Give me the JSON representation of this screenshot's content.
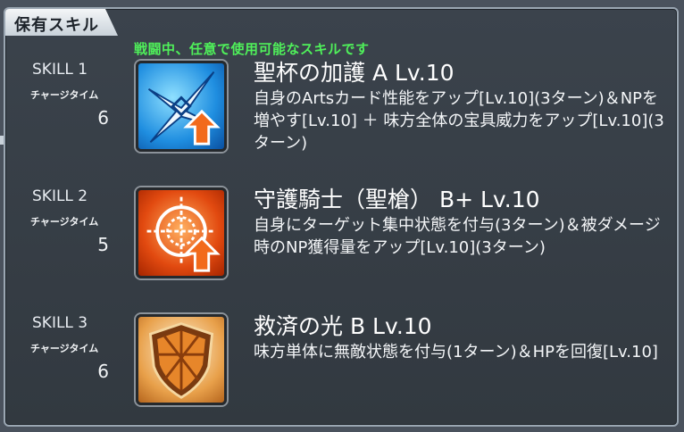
{
  "panel": {
    "tab_title": "保有スキル",
    "caption": "戦闘中、任意で使用可能なスキルです"
  },
  "skills": [
    {
      "label": "SKILL 1",
      "charge_label": "チャージタイム",
      "charge_time": "6",
      "name": "聖杯の加護 A Lv.10",
      "description": "自身のArtsカード性能をアップ[Lv.10](3ターン)＆NPを増やす[Lv.10] ＋ 味方全体の宝具威力をアップ[Lv.10](3ターン)",
      "icon": "arts-up-icon",
      "icon_color": "#1f8ee0"
    },
    {
      "label": "SKILL 2",
      "charge_label": "チャージタイム",
      "charge_time": "5",
      "name": "守護騎士（聖槍） B+ Lv.10",
      "description": "自身にターゲット集中状態を付与(3ターン)＆被ダメージ時のNP獲得量をアップ[Lv.10](3ターン)",
      "icon": "target-focus-icon",
      "icon_color": "#e24a10"
    },
    {
      "label": "SKILL 3",
      "charge_label": "チャージタイム",
      "charge_time": "6",
      "name": "救済の光 B Lv.10",
      "description": "味方単体に無敵状態を付与(1ターン)＆HPを回復[Lv.10]",
      "icon": "invincibility-shield-icon",
      "icon_color": "#e8a04a"
    }
  ]
}
